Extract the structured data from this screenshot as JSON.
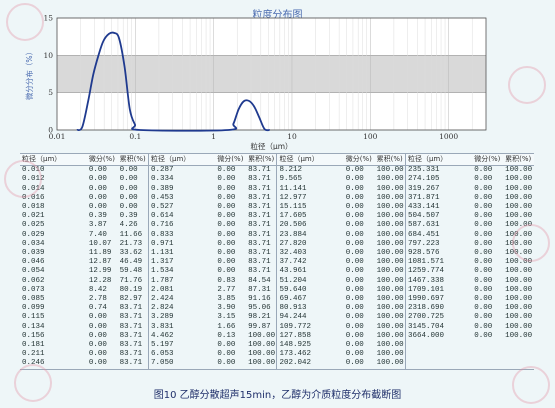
{
  "chart_title": "粒度分布图",
  "caption": "图10   乙醇分散超声15min，乙醇为介质粒度分布截断图",
  "colors": {
    "curve": "#1f3a8f",
    "band": "#d9d9d9",
    "background": "#eef6f8",
    "watermark": "#e08ca0"
  },
  "table": {
    "headers": [
      "粒径（μm）",
      "微分(%)",
      "累积(%)"
    ],
    "groups": [
      {
        "rows": [
          [
            "0.010",
            "0.00",
            "0.00"
          ],
          [
            "0.012",
            "0.00",
            "0.00"
          ],
          [
            "0.014",
            "0.00",
            "0.00"
          ],
          [
            "0.016",
            "0.00",
            "0.00"
          ],
          [
            "0.018",
            "0.00",
            "0.00"
          ],
          [
            "0.021",
            "0.39",
            "0.39"
          ],
          [
            "0.025",
            "3.87",
            "4.26"
          ],
          [
            "0.029",
            "7.40",
            "11.66"
          ],
          [
            "0.034",
            "10.07",
            "21.73"
          ],
          [
            "0.039",
            "11.89",
            "33.62"
          ],
          [
            "0.046",
            "12.87",
            "46.49"
          ],
          [
            "0.054",
            "12.99",
            "59.48"
          ],
          [
            "0.062",
            "12.28",
            "71.76"
          ],
          [
            "0.073",
            "8.42",
            "80.19"
          ],
          [
            "0.085",
            "2.78",
            "82.97"
          ],
          [
            "0.099",
            "0.74",
            "83.71"
          ],
          [
            "0.115",
            "0.00",
            "83.71"
          ],
          [
            "0.134",
            "0.00",
            "83.71"
          ],
          [
            "0.156",
            "0.00",
            "83.71"
          ],
          [
            "0.181",
            "0.00",
            "83.71"
          ],
          [
            "0.211",
            "0.00",
            "83.71"
          ],
          [
            "0.246",
            "0.00",
            "83.71"
          ]
        ]
      },
      {
        "rows": [
          [
            "0.287",
            "0.00",
            "83.71"
          ],
          [
            "0.334",
            "0.00",
            "83.71"
          ],
          [
            "0.389",
            "0.00",
            "83.71"
          ],
          [
            "0.453",
            "0.00",
            "83.71"
          ],
          [
            "0.527",
            "0.00",
            "83.71"
          ],
          [
            "0.614",
            "0.00",
            "83.71"
          ],
          [
            "0.716",
            "0.00",
            "83.71"
          ],
          [
            "0.833",
            "0.00",
            "83.71"
          ],
          [
            "0.971",
            "0.00",
            "83.71"
          ],
          [
            "1.131",
            "0.00",
            "83.71"
          ],
          [
            "1.317",
            "0.00",
            "83.71"
          ],
          [
            "1.534",
            "0.00",
            "83.71"
          ],
          [
            "1.787",
            "0.83",
            "84.54"
          ],
          [
            "2.081",
            "2.77",
            "87.31"
          ],
          [
            "2.424",
            "3.85",
            "91.16"
          ],
          [
            "2.824",
            "3.90",
            "95.06"
          ],
          [
            "3.289",
            "3.15",
            "98.21"
          ],
          [
            "3.831",
            "1.66",
            "99.87"
          ],
          [
            "4.462",
            "0.13",
            "100.00"
          ],
          [
            "5.197",
            "0.00",
            "100.00"
          ],
          [
            "6.053",
            "0.00",
            "100.00"
          ],
          [
            "7.050",
            "0.00",
            "100.00"
          ]
        ]
      },
      {
        "rows": [
          [
            "8.212",
            "0.00",
            "100.00"
          ],
          [
            "9.565",
            "0.00",
            "100.00"
          ],
          [
            "11.141",
            "0.00",
            "100.00"
          ],
          [
            "12.977",
            "0.00",
            "100.00"
          ],
          [
            "15.115",
            "0.00",
            "100.00"
          ],
          [
            "17.605",
            "0.00",
            "100.00"
          ],
          [
            "20.506",
            "0.00",
            "100.00"
          ],
          [
            "23.884",
            "0.00",
            "100.00"
          ],
          [
            "27.820",
            "0.00",
            "100.00"
          ],
          [
            "32.403",
            "0.00",
            "100.00"
          ],
          [
            "37.742",
            "0.00",
            "100.00"
          ],
          [
            "43.961",
            "0.00",
            "100.00"
          ],
          [
            "51.204",
            "0.00",
            "100.00"
          ],
          [
            "59.640",
            "0.00",
            "100.00"
          ],
          [
            "69.467",
            "0.00",
            "100.00"
          ],
          [
            "80.913",
            "0.00",
            "100.00"
          ],
          [
            "94.244",
            "0.00",
            "100.00"
          ],
          [
            "109.772",
            "0.00",
            "100.00"
          ],
          [
            "127.858",
            "0.00",
            "100.00"
          ],
          [
            "148.925",
            "0.00",
            "100.00"
          ],
          [
            "173.462",
            "0.00",
            "100.00"
          ],
          [
            "202.042",
            "0.00",
            "100.00"
          ]
        ]
      },
      {
        "rows": [
          [
            "235.331",
            "0.00",
            "100.00"
          ],
          [
            "274.105",
            "0.00",
            "100.00"
          ],
          [
            "319.267",
            "0.00",
            "100.00"
          ],
          [
            "371.871",
            "0.00",
            "100.00"
          ],
          [
            "433.141",
            "0.00",
            "100.00"
          ],
          [
            "504.507",
            "0.00",
            "100.00"
          ],
          [
            "587.631",
            "0.00",
            "100.00"
          ],
          [
            "684.451",
            "0.00",
            "100.00"
          ],
          [
            "797.223",
            "0.00",
            "100.00"
          ],
          [
            "928.576",
            "0.00",
            "100.00"
          ],
          [
            "1081.571",
            "0.00",
            "100.00"
          ],
          [
            "1259.774",
            "0.00",
            "100.00"
          ],
          [
            "1467.338",
            "0.00",
            "100.00"
          ],
          [
            "1709.101",
            "0.00",
            "100.00"
          ],
          [
            "1990.697",
            "0.00",
            "100.00"
          ],
          [
            "2318.690",
            "0.00",
            "100.00"
          ],
          [
            "2700.725",
            "0.00",
            "100.00"
          ],
          [
            "3145.704",
            "0.00",
            "100.00"
          ],
          [
            "3664.000",
            "0.00",
            "100.00"
          ],
          [
            "",
            "",
            ""
          ],
          [
            "",
            "",
            ""
          ],
          [
            "",
            "",
            ""
          ]
        ]
      }
    ]
  },
  "chart_data": {
    "type": "line",
    "title": "粒度分布图",
    "xlabel": "粒径（μm）",
    "ylabel": "微分分布（%）",
    "x_scale": "log",
    "xlim": [
      0.01,
      3000
    ],
    "ylim": [
      0,
      15
    ],
    "x_ticks": [
      "0.01",
      "0.1",
      "1",
      "10",
      "100",
      "1000"
    ],
    "y_ticks": [
      "0",
      "5",
      "10",
      "15"
    ],
    "grid": true,
    "highlight_band": [
      5,
      10
    ],
    "series": [
      {
        "x": [
          0.018,
          0.021,
          0.025,
          0.029,
          0.034,
          0.039,
          0.046,
          0.054,
          0.062,
          0.073,
          0.085,
          0.099,
          0.115,
          1.534,
          1.787,
          2.081,
          2.424,
          2.824,
          3.289,
          3.831,
          4.462,
          5.197
        ],
        "y": [
          0,
          0.39,
          3.87,
          7.4,
          10.07,
          11.89,
          12.87,
          12.99,
          12.28,
          8.42,
          2.78,
          0.74,
          0,
          0,
          0.83,
          2.77,
          3.85,
          3.9,
          3.15,
          1.66,
          0.13,
          0
        ]
      }
    ]
  }
}
